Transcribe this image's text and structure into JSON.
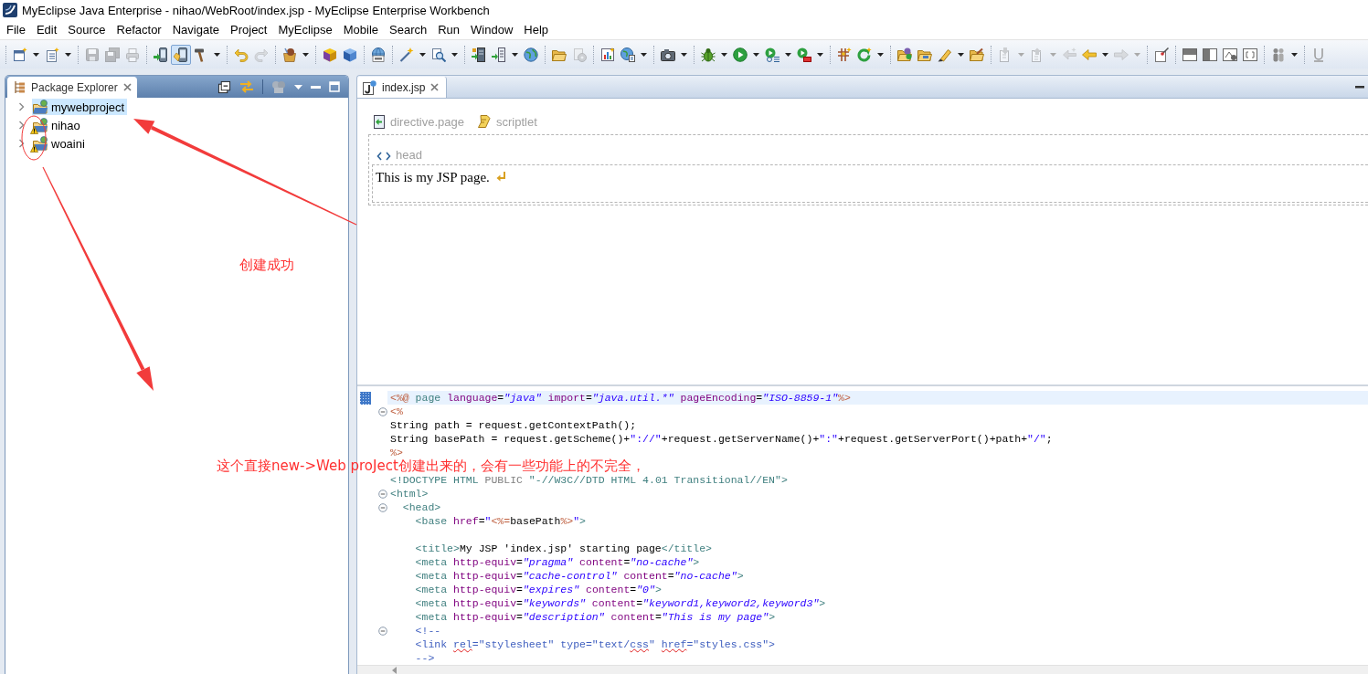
{
  "window": {
    "title": "MyEclipse Java Enterprise - nihao/WebRoot/index.jsp - MyEclipse Enterprise Workbench"
  },
  "menu": [
    "File",
    "Edit",
    "Source",
    "Refactor",
    "Navigate",
    "Project",
    "MyEclipse",
    "Mobile",
    "Search",
    "Run",
    "Window",
    "Help"
  ],
  "toolbar": {
    "buttons": [
      {
        "disabled": false,
        "pressed": false
      },
      {
        "disabled": false,
        "pressed": false
      },
      {
        "disabled": true,
        "pressed": false
      },
      {
        "disabled": true,
        "pressed": false
      },
      {
        "disabled": true,
        "pressed": false
      },
      {
        "disabled": false,
        "pressed": false
      },
      {
        "disabled": false,
        "pressed": true
      },
      {
        "disabled": false,
        "pressed": false
      },
      {
        "disabled": false,
        "pressed": false
      },
      {
        "disabled": true,
        "pressed": false
      },
      {
        "disabled": false,
        "pressed": false
      },
      {
        "disabled": false,
        "pressed": false
      },
      {
        "disabled": false,
        "pressed": false
      },
      {
        "disabled": false,
        "pressed": false
      },
      {
        "disabled": false,
        "pressed": false
      },
      {
        "disabled": false,
        "pressed": false
      },
      {
        "disabled": false,
        "pressed": false
      },
      {
        "disabled": false,
        "pressed": false
      },
      {
        "disabled": false,
        "pressed": false
      },
      {
        "disabled": false,
        "pressed": false
      },
      {
        "disabled": true,
        "pressed": false
      },
      {
        "disabled": false,
        "pressed": false
      },
      {
        "disabled": false,
        "pressed": false
      },
      {
        "disabled": false,
        "pressed": false
      },
      {
        "disabled": false,
        "pressed": false
      },
      {
        "disabled": false,
        "pressed": false
      },
      {
        "disabled": false,
        "pressed": false
      },
      {
        "disabled": false,
        "pressed": false
      },
      {
        "disabled": false,
        "pressed": false
      },
      {
        "disabled": false,
        "pressed": false
      },
      {
        "disabled": false,
        "pressed": false
      },
      {
        "disabled": false,
        "pressed": false
      },
      {
        "disabled": false,
        "pressed": false
      },
      {
        "disabled": false,
        "pressed": false
      },
      {
        "disabled": true,
        "pressed": false
      },
      {
        "disabled": true,
        "pressed": false
      },
      {
        "disabled": true,
        "pressed": false
      },
      {
        "disabled": false,
        "pressed": false
      },
      {
        "disabled": true,
        "pressed": false
      },
      {
        "disabled": false,
        "pressed": false
      },
      {
        "disabled": false,
        "pressed": false
      },
      {
        "disabled": false,
        "pressed": false
      },
      {
        "disabled": false,
        "pressed": false
      },
      {
        "disabled": false,
        "pressed": false
      },
      {
        "disabled": false,
        "pressed": false
      },
      {
        "disabled": false,
        "pressed": false
      }
    ]
  },
  "explorer": {
    "tab": {
      "label": "Package Explorer",
      "selected": true
    },
    "items": [
      {
        "label": "mywebproject",
        "selected": true,
        "expanded": false,
        "warning": false
      },
      {
        "label": "nihao",
        "selected": false,
        "expanded": false,
        "warning": true
      },
      {
        "label": "woaini",
        "selected": false,
        "expanded": false,
        "warning": true
      }
    ]
  },
  "editor": {
    "tabs": [
      {
        "label": "index.jsp",
        "selected": true
      }
    ],
    "design": {
      "elements": [
        {
          "kind": "directive",
          "label": "directive.page"
        },
        {
          "kind": "scriptlet",
          "label": "scriptlet"
        }
      ],
      "head": {
        "label": "head"
      },
      "body_text": "This is my JSP page."
    },
    "source": {
      "lines": [
        {
          "current": true,
          "folding": false,
          "segments": [
            {
              "kind": "jsp",
              "text": "<%@"
            },
            {
              "kind": "directive",
              "text": " page"
            },
            {
              "kind": "attr",
              "text": " language"
            },
            {
              "kind": "code",
              "text": "="
            },
            {
              "kind": "value",
              "text": "\"java\""
            },
            {
              "kind": "attr",
              "text": " import"
            },
            {
              "kind": "code",
              "text": "="
            },
            {
              "kind": "value",
              "text": "\"java.util.*\""
            },
            {
              "kind": "attr",
              "text": " pageEncoding"
            },
            {
              "kind": "code",
              "text": "="
            },
            {
              "kind": "value",
              "text": "\"ISO-8859-1\""
            },
            {
              "kind": "jsp",
              "text": "%>"
            }
          ]
        },
        {
          "current": false,
          "folding": true,
          "segments": [
            {
              "kind": "jsp",
              "text": "<%"
            }
          ]
        },
        {
          "current": false,
          "folding": false,
          "segments": [
            {
              "kind": "code",
              "text": "String path = request.getContextPath();"
            }
          ]
        },
        {
          "current": false,
          "folding": false,
          "segments": [
            {
              "kind": "code",
              "text": "String basePath = request.getScheme()+"
            },
            {
              "kind": "string",
              "text": "\"://\""
            },
            {
              "kind": "code",
              "text": "+request.getServerName()+"
            },
            {
              "kind": "string",
              "text": "\":\""
            },
            {
              "kind": "code",
              "text": "+request.getServerPort()+path+"
            },
            {
              "kind": "string",
              "text": "\"/\""
            },
            {
              "kind": "code",
              "text": ";"
            }
          ]
        },
        {
          "current": false,
          "folding": false,
          "segments": [
            {
              "kind": "jsp",
              "text": "%>"
            }
          ]
        },
        {
          "current": false,
          "folding": false
        },
        {
          "current": false,
          "folding": false,
          "segments": [
            {
              "kind": "tag",
              "text": "<!DOCTYPE HTML "
            },
            {
              "kind": "keyword",
              "text": "PUBLIC"
            },
            {
              "kind": "tag",
              "text": " \"-//W3C//DTD HTML 4.01 Transitional//EN\">"
            }
          ]
        },
        {
          "current": false,
          "folding": true,
          "segments": [
            {
              "kind": "tag",
              "text": "<html>"
            }
          ]
        },
        {
          "current": false,
          "folding": true,
          "segments": [
            {
              "kind": "tag",
              "text": "  <head>"
            }
          ]
        },
        {
          "current": false,
          "folding": false,
          "segments": [
            {
              "kind": "tag",
              "text": "    <base"
            },
            {
              "kind": "attr",
              "text": " href"
            },
            {
              "kind": "code",
              "text": "="
            },
            {
              "kind": "string",
              "text": "\""
            },
            {
              "kind": "jsp",
              "text": "<%="
            },
            {
              "kind": "code",
              "text": "basePath"
            },
            {
              "kind": "jsp",
              "text": "%>"
            },
            {
              "kind": "string",
              "text": "\""
            },
            {
              "kind": "tag",
              "text": ">"
            }
          ]
        },
        {
          "current": false,
          "folding": false
        },
        {
          "current": false,
          "folding": false,
          "segments": [
            {
              "kind": "tag",
              "text": "    <title>"
            },
            {
              "kind": "code",
              "text": "My JSP 'index.jsp' starting page"
            },
            {
              "kind": "tag",
              "text": "</title>"
            }
          ]
        },
        {
          "current": false,
          "folding": false,
          "segments": [
            {
              "kind": "tag",
              "text": "    <meta"
            },
            {
              "kind": "attr",
              "text": " http-equiv"
            },
            {
              "kind": "code",
              "text": "="
            },
            {
              "kind": "value",
              "text": "\"pragma\""
            },
            {
              "kind": "attr",
              "text": " content"
            },
            {
              "kind": "code",
              "text": "="
            },
            {
              "kind": "value",
              "text": "\"no-cache\""
            },
            {
              "kind": "tag",
              "text": ">"
            }
          ]
        },
        {
          "current": false,
          "folding": false,
          "segments": [
            {
              "kind": "tag",
              "text": "    <meta"
            },
            {
              "kind": "attr",
              "text": " http-equiv"
            },
            {
              "kind": "code",
              "text": "="
            },
            {
              "kind": "value",
              "text": "\"cache-control\""
            },
            {
              "kind": "attr",
              "text": " content"
            },
            {
              "kind": "code",
              "text": "="
            },
            {
              "kind": "value",
              "text": "\"no-cache\""
            },
            {
              "kind": "tag",
              "text": ">"
            }
          ]
        },
        {
          "current": false,
          "folding": false,
          "segments": [
            {
              "kind": "tag",
              "text": "    <meta"
            },
            {
              "kind": "attr",
              "text": " http-equiv"
            },
            {
              "kind": "code",
              "text": "="
            },
            {
              "kind": "value",
              "text": "\"expires\""
            },
            {
              "kind": "attr",
              "text": " content"
            },
            {
              "kind": "code",
              "text": "="
            },
            {
              "kind": "value",
              "text": "\"0\""
            },
            {
              "kind": "tag",
              "text": ">"
            }
          ]
        },
        {
          "current": false,
          "folding": false,
          "segments": [
            {
              "kind": "tag",
              "text": "    <meta"
            },
            {
              "kind": "attr",
              "text": " http-equiv"
            },
            {
              "kind": "code",
              "text": "="
            },
            {
              "kind": "value",
              "text": "\"keywords\""
            },
            {
              "kind": "attr",
              "text": " content"
            },
            {
              "kind": "code",
              "text": "="
            },
            {
              "kind": "value",
              "text": "\"keyword1,keyword2,keyword3\""
            },
            {
              "kind": "tag",
              "text": ">"
            }
          ]
        },
        {
          "current": false,
          "folding": false,
          "segments": [
            {
              "kind": "tag",
              "text": "    <meta"
            },
            {
              "kind": "attr",
              "text": " http-equiv"
            },
            {
              "kind": "code",
              "text": "="
            },
            {
              "kind": "value",
              "text": "\"description\""
            },
            {
              "kind": "attr",
              "text": " content"
            },
            {
              "kind": "code",
              "text": "="
            },
            {
              "kind": "value",
              "text": "\"This is my page\""
            },
            {
              "kind": "tag",
              "text": ">"
            }
          ]
        },
        {
          "current": false,
          "folding": true,
          "segments": [
            {
              "kind": "comment",
              "text": "    <!--"
            }
          ]
        },
        {
          "current": false,
          "folding": false,
          "segments": [
            {
              "kind": "comment",
              "text": "    <link "
            },
            {
              "kind": "misspelled",
              "text": "rel"
            },
            {
              "kind": "comment",
              "text": "=\"stylesheet\" type=\"text/"
            },
            {
              "kind": "misspelled",
              "text": "css"
            },
            {
              "kind": "comment",
              "text": "\" "
            },
            {
              "kind": "misspelled",
              "text": "href"
            },
            {
              "kind": "comment",
              "text": "=\"styles.css\">"
            }
          ]
        },
        {
          "current": false,
          "folding": false,
          "segments": [
            {
              "kind": "comment",
              "text": "    -->"
            }
          ]
        }
      ]
    }
  },
  "annotations": [
    {
      "text": "创建成功"
    },
    {
      "text": "这个直接new->Web proJect创建出来的，会有一些功能上的不完全，"
    }
  ]
}
